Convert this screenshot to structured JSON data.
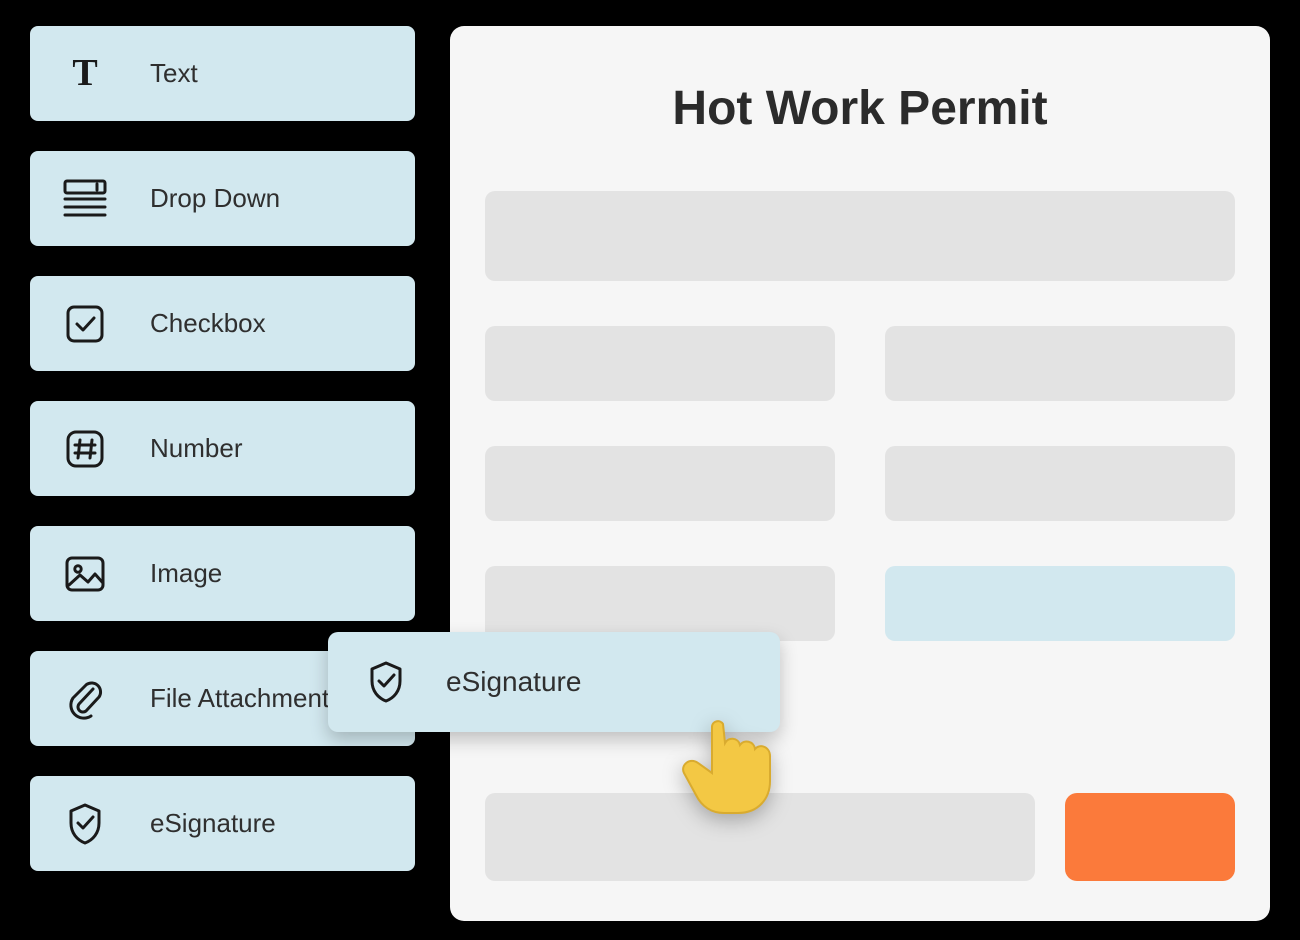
{
  "sidebar": {
    "items": [
      {
        "label": "Text",
        "icon": "text-icon"
      },
      {
        "label": "Drop Down",
        "icon": "dropdown-icon"
      },
      {
        "label": "Checkbox",
        "icon": "checkbox-icon"
      },
      {
        "label": "Number",
        "icon": "number-icon"
      },
      {
        "label": "Image",
        "icon": "image-icon"
      },
      {
        "label": "File Attachment",
        "icon": "attachment-icon"
      },
      {
        "label": "eSignature",
        "icon": "shield-check-icon"
      }
    ]
  },
  "canvas": {
    "title": "Hot Work Permit"
  },
  "drag": {
    "label": "eSignature",
    "icon": "shield-check-icon"
  },
  "colors": {
    "tile_bg": "#d2e8ef",
    "canvas_bg": "#f6f6f6",
    "placeholder": "#e3e3e3",
    "accent": "#fb7a3b",
    "cursor": "#f3c844"
  }
}
